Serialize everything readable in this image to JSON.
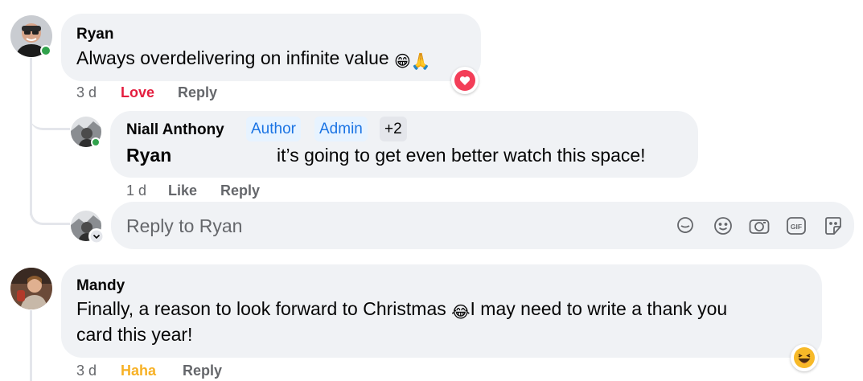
{
  "comments": [
    {
      "author": "Ryan",
      "text": "Always overdelivering on infinite value ",
      "emojis": [
        "😁",
        "🙏"
      ],
      "time": "3 d",
      "reaction_label": "Love",
      "reply_label": "Reply",
      "reaction_badge": "heart-reaction"
    },
    {
      "author": "Mandy",
      "text_line1": "Finally, a reason to look forward to Christmas ",
      "text_line1_after": "I may need to write a thank you",
      "text_line2": "card this year!",
      "emoji": "😂",
      "time": "3 d",
      "reaction_label": "Haha",
      "reply_label": "Reply",
      "reaction_badge": "haha-reaction"
    }
  ],
  "reply": {
    "author": "Niall Anthony",
    "badges": [
      "Author",
      "Admin",
      "+2"
    ],
    "mention": "Ryan",
    "text": "it’s going to get even better watch this space!",
    "time": "1 d",
    "like_label": "Like",
    "reply_label": "Reply"
  },
  "composer": {
    "placeholder": "Reply to Ryan",
    "tools": [
      "avatar-sticker-icon",
      "emoji-icon",
      "camera-icon",
      "gif-icon",
      "sticker-icon"
    ]
  },
  "colors": {
    "bubble": "#f0f2f5",
    "love": "#e41e3f",
    "haha": "#f7b125",
    "badge_text": "#1b74e4",
    "badge_bg": "#e7f3ff",
    "online": "#31a24c"
  }
}
